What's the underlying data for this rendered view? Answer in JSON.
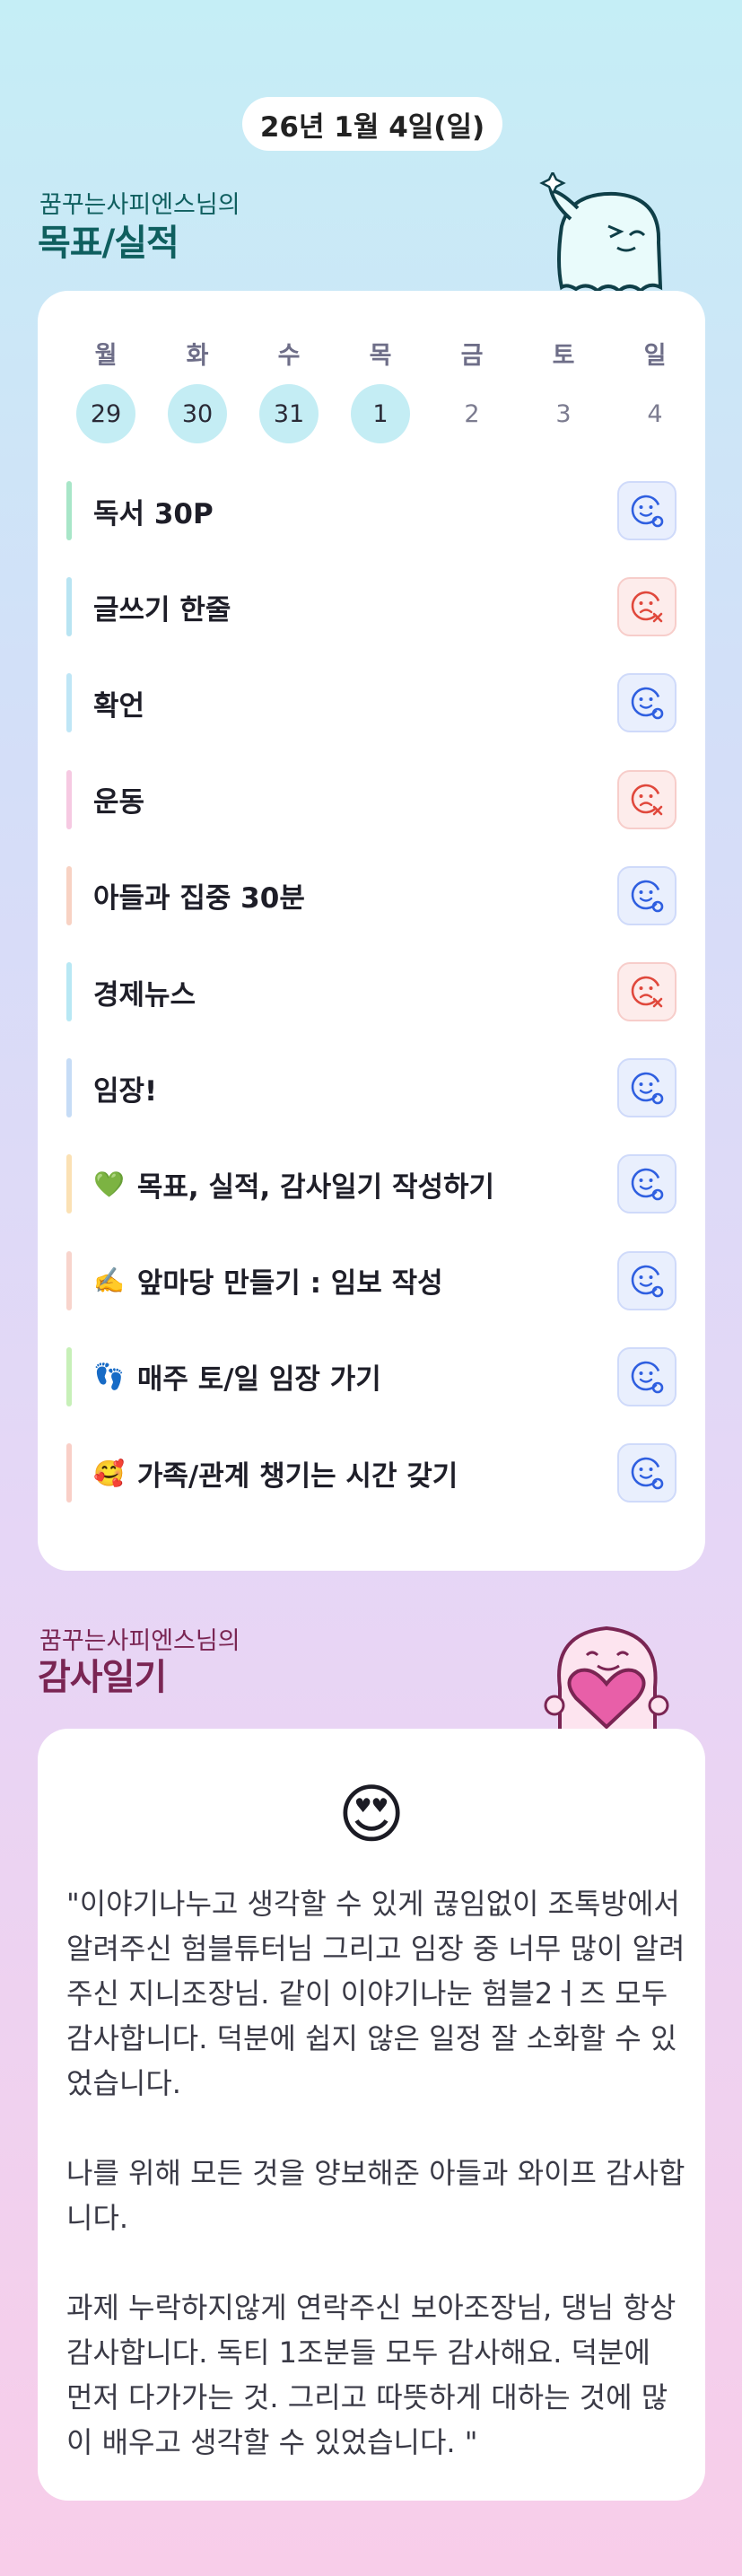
{
  "header": {
    "date": "26년 1월 4일(일)"
  },
  "goals_section": {
    "subtitle": "꿈꾸는사피엔스님의",
    "title": "목표/실적"
  },
  "week": {
    "days": [
      {
        "label": "월",
        "date": "29",
        "done": true
      },
      {
        "label": "화",
        "date": "30",
        "done": true
      },
      {
        "label": "수",
        "date": "31",
        "done": true
      },
      {
        "label": "목",
        "date": "1",
        "done": true
      },
      {
        "label": "금",
        "date": "2",
        "done": false
      },
      {
        "label": "토",
        "date": "3",
        "done": false
      },
      {
        "label": "일",
        "date": "4",
        "done": false
      }
    ]
  },
  "goals": [
    {
      "text": "독서 30P",
      "emoji": "",
      "status": "achieved",
      "bar_color": "#a8e6c8"
    },
    {
      "text": "글쓰기 한줄",
      "emoji": "",
      "status": "missed",
      "bar_color": "#b8e4f2"
    },
    {
      "text": "확언",
      "emoji": "",
      "status": "achieved",
      "bar_color": "#bfe6f6"
    },
    {
      "text": "운동",
      "emoji": "",
      "status": "missed",
      "bar_color": "#f6c9e2"
    },
    {
      "text": "아들과 집중 30분",
      "emoji": "",
      "status": "achieved",
      "bar_color": "#f8d2c3"
    },
    {
      "text": "경제뉴스",
      "emoji": "",
      "status": "missed",
      "bar_color": "#b8e8f4"
    },
    {
      "text": "임장!",
      "emoji": "",
      "status": "achieved",
      "bar_color": "#c6dcf6"
    },
    {
      "text": "목표, 실적, 감사일기 작성하기",
      "emoji": "💚",
      "status": "achieved",
      "bar_color": "#fbe1b4"
    },
    {
      "text": "앞마당 만들기 : 임보 작성",
      "emoji": "✍️",
      "status": "achieved",
      "bar_color": "#f8d4cc"
    },
    {
      "text": "매주 토/일 임장 가기",
      "emoji": "👣",
      "status": "achieved",
      "bar_color": "#c7f0b8"
    },
    {
      "text": "가족/관계 챙기는 시간 갖기",
      "emoji": "🥰",
      "status": "achieved",
      "bar_color": "#f9cfc7"
    }
  ],
  "gratitude_section": {
    "subtitle": "꿈꾸는사피엔스님의",
    "title": "감사일기",
    "emoji": "😍",
    "paragraphs": [
      "\"이야기나누고 생각할 수 있게 끊임없이 조톡방에서 알려주신 험블튜터님 그리고 임장 중 너무 많이 알려주신 지니조장님. 같이 이야기나눈 험블2ㅓ즈 모두 감사합니다. 덕분에 쉽지 않은 일정 잘 소화할 수 있었습니다.",
      "나를 위해 모든 것을 양보해준 아들과 와이프 감사합니다.",
      "과제 누락하지않게 연락주신 보아조장님, 댕님 항상 감사합니다. 독티 1조분들 모두 감사해요. 덕분에 먼저 다가가는 것. 그리고 따뜻하게 대하는 것에 많이 배우고 생각할 수 있었습니다. \""
    ]
  },
  "colors": {
    "goal_title": "#0f5f5f",
    "gratitude_title": "#7a2553",
    "achieved_icon": "#2f5fe0",
    "missed_icon": "#e0483c"
  }
}
